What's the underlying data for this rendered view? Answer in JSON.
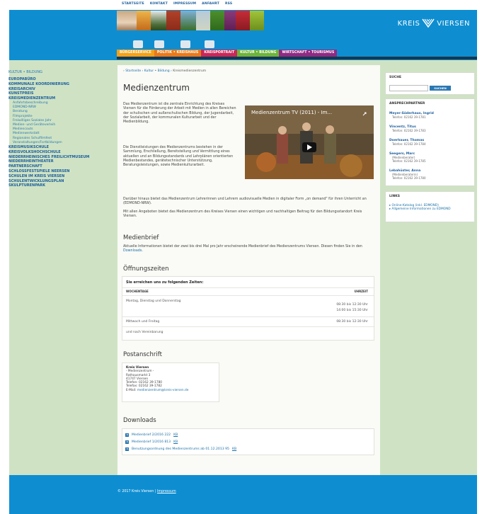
{
  "topnav": [
    "STARTSEITE",
    "KONTAKT",
    "IMPRESSUM",
    "ANFAHRT",
    "RSS"
  ],
  "logo": {
    "text_left": "KREIS",
    "text_right": "VIERSEN"
  },
  "mainnav": [
    {
      "label": "BÜRGERSERVICE",
      "color": "#f2a11a"
    },
    {
      "label": "POLITIK • KREISHAUS",
      "color": "#e87a1c"
    },
    {
      "label": "KREISPORTRAIT",
      "color": "#c8285a"
    },
    {
      "label": "KULTUR • BILDUNG",
      "color": "#6db43c"
    },
    {
      "label": "WIRTSCHAFT • TOURISMUS",
      "color": "#8e2b84"
    }
  ],
  "leftnav": {
    "category": "KULTUR • BILDUNG",
    "items_top": [
      "EUROPABÜRO",
      "KOMMUNALE KOORDINIERUNG",
      "KREISARCHIV",
      "KUNSTPREIS",
      "KREISMEDIENZENTRUM"
    ],
    "subitems": [
      "Anfahrtsbeschreibung",
      "EDMOND-NRW",
      "Beratung",
      "Filmprojekte",
      "Freiwilliges Soziales Jahr",
      "Medien- und Geräteverleih",
      "Mediencouts",
      "Medienwerkstatt",
      "Regionales Schulfilmfest",
      "Veranstaltungen/Fortbildungen"
    ],
    "items_bottom": [
      "KREISMUSIKSCHULE",
      "KREISVOLKSHOCHSCHULE",
      "NIEDERRHEINISCHES FREILICHTMUSEUM",
      "NIEDERRHEINTHEATER",
      "PARTNERSCHAFT",
      "SCHLOSSFESTSPIELE NEERSEN",
      "SCHULEN IM KREIS VIERSEN",
      "SCHULENTWICKLUNGSPLAN",
      "SKULPTURENPARK"
    ]
  },
  "breadcrumb": {
    "items": [
      "Startseite",
      "Kultur • Bildung"
    ],
    "current": "Kreismedienzentrum"
  },
  "page_title": "Medienzentrum",
  "intro_text": "Das Medienzentrum ist die zentrale Einrichtung des Kreises Viersen für die Förderung der Arbeit mit Medien in allen Bereichen der schulischen und außerschulischen Bildung, der Jugendarbeit, der Sozialarbeit, der kommunalen Kulturarbeit und der Medienbildung.",
  "intro_text2": "Die Dienstleistungen des Medienzentrums bestehen in der Sammlung, Erschließung, Bereitstellung und Vermittlung eines aktuellen und an Bildungsstandards und Lehrplänen orientierten Medienbestandes, gerätetechnischer Unterstützung, Beratungsleistungen, sowie Medienkulturarbeit.",
  "video": {
    "title": "Medienzentrum TV (2011) - Im..."
  },
  "para3": "Darüber hinaus bietet das Medienzentrum Lehrerinnen und Lehrern audiovisuelle Medien in digitaler Form „on demand\" für ihren Unterricht an (EDMOND-NRW).",
  "para4": "Mit allen Angeboten bietet das Medienzentrum des Kreises Viersen einen wichtigen und nachhaltigen Beitrag für den Bildungsstandort Kreis Viersen.",
  "medienbrief": {
    "heading": "Medienbrief",
    "text": "Aktuelle Informationen bietet der zwei bis drei Mal pro Jahr erscheinende Medienbrief des Medienzentrums Viersen. Diesen finden Sie in den",
    "link": "Downloads",
    "tail": "."
  },
  "hours": {
    "heading": "Öffnungszeiten",
    "box_title": "Sie erreichen uns zu folgenden Zeiten:",
    "col_day": "WOCHENTAGE",
    "col_time": "UHRZEIT",
    "rows": [
      {
        "day": "Montag, Dienstag und Donnerstag",
        "time1": "08:30 bis 12:30 Uhr",
        "time2": "14:00 bis 15:30 Uhr"
      },
      {
        "day": "Mittwoch und Freitag",
        "time1": "08:30 bis 12:30 Uhr"
      }
    ],
    "note": "und nach Vereinbarung"
  },
  "address": {
    "heading": "Postanschrift",
    "lines": [
      "Kreis Viersen",
      "- Medienzentrum -",
      "Rathausmarkt 3",
      "41747 Viersen",
      "Telefon: 02162 39-1780",
      "Telefax: 02162 39-1782"
    ],
    "email_label": "E-Mail:",
    "email": "medienzentrum@kreis-viersen.de"
  },
  "downloads": {
    "heading": "Downloads",
    "items": [
      {
        "text": "Medienbrief 2/2016 222",
        "unit": "KB"
      },
      {
        "text": "Medienbrief 1/2016 813",
        "unit": "KB"
      },
      {
        "text": "Benutzungsordnung des Medienzentrums ab 01.12.2013 95",
        "unit": "KB"
      }
    ]
  },
  "search": {
    "title": "SUCHE",
    "button": "SUCHEN",
    "placeholder": ""
  },
  "contacts": {
    "title": "ANSPRECHPARTNER",
    "people": [
      {
        "name": "Meyer-Söderhaus, Ingrid",
        "details": [
          "Telefon: 02162 39-1781"
        ]
      },
      {
        "name": "Vincentz, Titus",
        "details": [
          "Telefon: 02162 39-1783"
        ]
      },
      {
        "name": "Doerhauer, Thomas",
        "details": [
          "Telefon: 02162 39-1784"
        ]
      },
      {
        "name": "Seegers, Marc",
        "details": [
          "(Medienberater)",
          "Telefon: 02162 39-1785"
        ]
      },
      {
        "name": "Lebahüster, Anna",
        "details": [
          "(Medienberaterin)",
          "Telefon: 02162 39-1780"
        ]
      }
    ]
  },
  "links": {
    "title": "LINKS",
    "items": [
      "Online-Katalog (inkl. EDMOND)",
      "Allgemeine Informationen zu EDMOND"
    ]
  },
  "footer": {
    "copyright": "© 2017 Kreis Viersen |",
    "link": "Impressum"
  }
}
